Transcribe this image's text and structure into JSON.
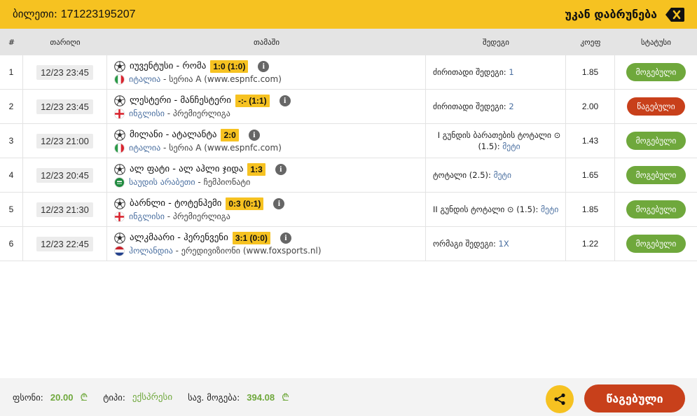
{
  "header": {
    "ticket_label": "ბილეთი:",
    "ticket_number": "171223195207",
    "back_label": "უკან დაბრუნება"
  },
  "columns": {
    "num": "#",
    "date": "თარიღი",
    "game": "თამაში",
    "result": "შედეგი",
    "odd": "კოეფ",
    "status": "სტატუსი"
  },
  "rows": [
    {
      "num": "1",
      "date": "12/23 23:45",
      "teams": "იუვენტუსი - რომა",
      "score": "1:0 (1:0)",
      "country": "იტალია",
      "league": " - სერია A (www.espnfc.com)",
      "flag": "italy",
      "result_label": "ძირითადი შედეგი:",
      "result_value": "1",
      "odd": "1.85",
      "status": "მოგებული",
      "status_type": "won"
    },
    {
      "num": "2",
      "date": "12/23 23:45",
      "teams": "ლესტერი - მანჩესტერი",
      "score": "-:- (1:1)",
      "country": "ინგლისი",
      "league": " - პრემიერლიგა",
      "flag": "england",
      "result_label": "ძირითადი შედეგი:",
      "result_value": "2",
      "odd": "2.00",
      "status": "წაგებული",
      "status_type": "lost"
    },
    {
      "num": "3",
      "date": "12/23 21:00",
      "teams": "მილანი - ატალანტა",
      "score": "2:0",
      "country": "იტალია",
      "league": " - სერია A (www.espnfc.com)",
      "flag": "italy",
      "result_label": "I გუნდის ბარათების ტოტალი ⊙ (1.5):",
      "result_value": "მეტი",
      "odd": "1.43",
      "status": "მოგებული",
      "status_type": "won"
    },
    {
      "num": "4",
      "date": "12/23 20:45",
      "teams": "ალ ფატი - ალ აჰლი ჯიდა",
      "score": "1:3",
      "country": "საუდის არაბეთი",
      "league": " - ჩემპიონატი",
      "flag": "saudi",
      "result_label": "ტოტალი (2.5):",
      "result_value": "მეტი",
      "odd": "1.65",
      "status": "მოგებული",
      "status_type": "won"
    },
    {
      "num": "5",
      "date": "12/23 21:30",
      "teams": "ბარნლი - ტოტენჰემი",
      "score": "0:3 (0:1)",
      "country": "ინგლისი",
      "league": " - პრემიერლიგა",
      "flag": "england",
      "result_label": "II გუნდის ტოტალი ⊙ (1.5):",
      "result_value": "მეტი",
      "odd": "1.85",
      "status": "მოგებული",
      "status_type": "won"
    },
    {
      "num": "6",
      "date": "12/23 22:45",
      "teams": "ალკმაარი - ჰერენვენი",
      "score": "3:1 (0:0)",
      "country": "ჰოლანდია",
      "league": " - ერედივიზიონი (www.foxsports.nl)",
      "flag": "netherlands",
      "result_label": "ორმაგი შედეგი:",
      "result_value": "1X",
      "odd": "1.22",
      "status": "მოგებული",
      "status_type": "won"
    }
  ],
  "footer": {
    "stake_label": "ფსონი:",
    "stake_value": "20.00",
    "type_label": "ტიპი:",
    "type_value": "ექსპრესი",
    "win_label": "სავ. მოგება:",
    "win_value": "394.08",
    "currency_symbol": "₾",
    "final_status": "წაგებული"
  },
  "colors": {
    "accent": "#f6c221",
    "won": "#6fa83c",
    "lost": "#c8401b",
    "link": "#4a6fa0"
  },
  "icons": {
    "back": "backspace-icon",
    "ball": "soccer-ball-icon",
    "info": "info-icon",
    "share": "share-icon"
  }
}
